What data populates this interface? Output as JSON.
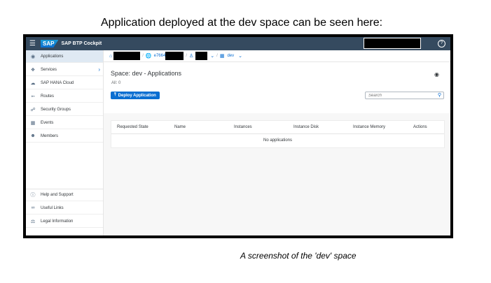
{
  "caption_top": "Application deployed at the dev space can be seen here:",
  "caption_bottom": "A screenshot of the 'dev' space",
  "shell": {
    "logo": "SAP",
    "product": "SAP BTP Cockpit",
    "help_icon": "help-icon"
  },
  "sidebar": {
    "items": [
      {
        "label": "Applications",
        "icon": "applications-icon",
        "active": true
      },
      {
        "label": "Services",
        "icon": "services-icon",
        "has_arrow": true
      },
      {
        "label": "SAP HANA Cloud",
        "icon": "cloud-icon"
      },
      {
        "label": "Routes",
        "icon": "routes-icon"
      },
      {
        "label": "Security Groups",
        "icon": "security-groups-icon"
      },
      {
        "label": "Events",
        "icon": "events-icon"
      },
      {
        "label": "Members",
        "icon": "members-icon"
      }
    ],
    "footer": [
      {
        "label": "Help and Support",
        "icon": "help-icon"
      },
      {
        "label": "Useful Links",
        "icon": "link-icon"
      },
      {
        "label": "Legal Information",
        "icon": "legal-icon"
      }
    ]
  },
  "breadcrumbs": {
    "subaccount_prefix": "e7664",
    "space": "dev"
  },
  "page": {
    "title": "Space: dev - Applications",
    "count": "All: 0",
    "deploy_button": "Deploy Application",
    "search_placeholder": "Search"
  },
  "table": {
    "columns": [
      "Requested State",
      "Name",
      "Instances",
      "Instance Disk",
      "Instance Memory",
      "Actions"
    ],
    "empty_text": "No applications"
  },
  "colors": {
    "shell": "#354a5f",
    "accent": "#0a6ed1",
    "active_nav": "#dfe9f3"
  }
}
